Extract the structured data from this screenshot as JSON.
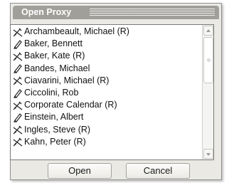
{
  "window": {
    "title": "Open Proxy"
  },
  "proxies": [
    {
      "name": "Archambeault, Michael (R)",
      "icon": "read-only-proxy-icon"
    },
    {
      "name": "Baker, Bennett",
      "icon": "edit-proxy-icon"
    },
    {
      "name": "Baker, Kate (R)",
      "icon": "read-only-proxy-icon"
    },
    {
      "name": "Bandes, Michael",
      "icon": "edit-proxy-icon"
    },
    {
      "name": "Ciavarini, Michael (R)",
      "icon": "read-only-proxy-icon"
    },
    {
      "name": "Ciccolini, Rob",
      "icon": "edit-proxy-icon"
    },
    {
      "name": "Corporate Calendar (R)",
      "icon": "read-only-proxy-icon"
    },
    {
      "name": "Einstein, Albert",
      "icon": "edit-proxy-icon"
    },
    {
      "name": "Ingles, Steve (R)",
      "icon": "read-only-proxy-icon"
    },
    {
      "name": "Kahn, Peter (R)",
      "icon": "read-only-proxy-icon"
    }
  ],
  "buttons": {
    "open": "Open",
    "cancel": "Cancel"
  }
}
